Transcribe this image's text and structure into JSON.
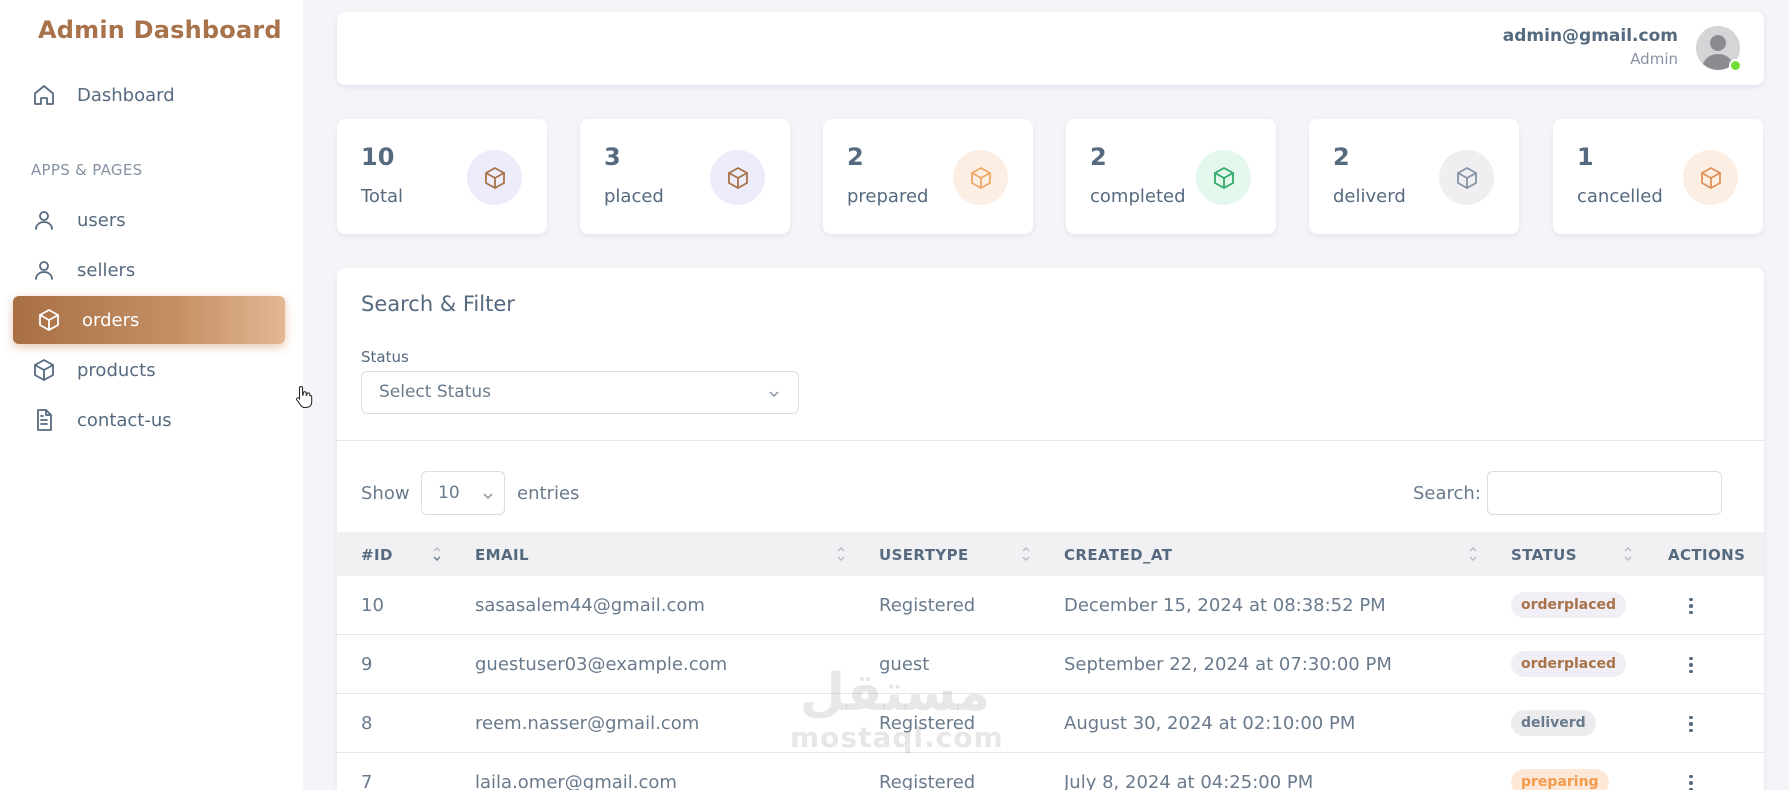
{
  "app": {
    "brand": "Admin Dashboard"
  },
  "sidebar": {
    "dashboard_label": "Dashboard",
    "section_header": "APPS & PAGES",
    "items": [
      {
        "label": "users",
        "icon": "user-icon"
      },
      {
        "label": "sellers",
        "icon": "user-icon"
      },
      {
        "label": "orders",
        "icon": "box-icon",
        "active": true
      },
      {
        "label": "products",
        "icon": "box-icon"
      },
      {
        "label": "contact-us",
        "icon": "document-icon"
      }
    ]
  },
  "navbar": {
    "email": "admin@gmail.com",
    "role": "Admin"
  },
  "stats": [
    {
      "value": "10",
      "label": "Total",
      "color": "#8a84d6",
      "bg": "#edecfb"
    },
    {
      "value": "3",
      "label": "placed",
      "color": "#8a84d6",
      "bg": "#edecfb"
    },
    {
      "value": "2",
      "label": "prepared",
      "color": "#f0a766",
      "bg": "#fdeee4"
    },
    {
      "value": "2",
      "label": "completed",
      "color": "#3ec47f",
      "bg": "#e3f7ec"
    },
    {
      "value": "2",
      "label": "deliverd",
      "color": "#8592a3",
      "bg": "#efeff1"
    },
    {
      "value": "1",
      "label": "cancelled",
      "color": "#f0a766",
      "bg": "#fdeee4"
    }
  ],
  "filter": {
    "title": "Search & Filter",
    "status_label": "Status",
    "status_placeholder": "Select Status"
  },
  "table_controls": {
    "show_label": "Show",
    "entries_value": "10",
    "entries_label": "entries",
    "search_label": "Search:"
  },
  "table": {
    "columns": [
      "#ID",
      "EMAIL",
      "USERTYPE",
      "CREATED_AT",
      "STATUS",
      "ACTIONS"
    ],
    "rows": [
      {
        "id": "10",
        "email": "sasasalem44@gmail.com",
        "usertype": "Registered",
        "created_at": "December 15, 2024 at 08:38:52 PM",
        "status": "orderplaced",
        "status_kind": "placed"
      },
      {
        "id": "9",
        "email": "guestuser03@example.com",
        "usertype": "guest",
        "created_at": "September 22, 2024 at 07:30:00 PM",
        "status": "orderplaced",
        "status_kind": "placed"
      },
      {
        "id": "8",
        "email": "reem.nasser@gmail.com",
        "usertype": "Registered",
        "created_at": "August 30, 2024 at 02:10:00 PM",
        "status": "deliverd",
        "status_kind": "deliv"
      },
      {
        "id": "7",
        "email": "laila.omer@gmail.com",
        "usertype": "Registered",
        "created_at": "July 8, 2024 at 04:25:00 PM",
        "status": "preparing",
        "status_kind": "prep"
      }
    ]
  },
  "watermark": {
    "arabic": "مستقل",
    "latin": "mostaql.com"
  }
}
